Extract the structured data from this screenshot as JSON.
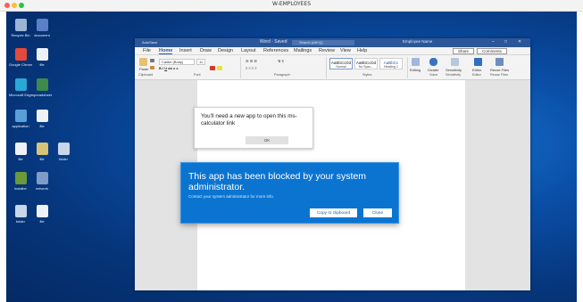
{
  "window": {
    "title": "W-EMPLOYEES",
    "dot_colors": [
      "#fe5f57",
      "#febc2e",
      "#28c840"
    ]
  },
  "desktop": {
    "icons": [
      {
        "name": "recycle-bin-icon",
        "label": "Recycle Bin",
        "color": "#9bb6d6"
      },
      {
        "name": "document-icon",
        "label": "document",
        "color": "#5b7fc8"
      },
      {
        "name": "chrome-icon",
        "label": "Google Chrome",
        "color": "#e34a3b"
      },
      {
        "name": "file-icon",
        "label": "file",
        "color": "#eef2f8"
      },
      {
        "name": "edge-icon",
        "label": "Microsoft Edge",
        "color": "#2aa7d8"
      },
      {
        "name": "spreadsheet-icon",
        "label": "spreadsheet",
        "color": "#3d8a4a"
      },
      {
        "name": "app-icon",
        "label": "application",
        "color": "#5aa0d8"
      },
      {
        "name": "file-icon",
        "label": "file",
        "color": "#eef2f8"
      },
      {
        "name": "file-icon",
        "label": "file",
        "color": "#eef2f8"
      },
      {
        "name": "file-icon",
        "label": "file",
        "color": "#d8c37a"
      },
      {
        "name": "folder-icon",
        "label": "folder",
        "color": "#c8d6ea"
      },
      {
        "name": "installer-icon",
        "label": "installer",
        "color": "#6a9a3a"
      },
      {
        "name": "network-icon",
        "label": "network",
        "color": "#7e9cc6"
      },
      {
        "name": "folder-icon",
        "label": "folder",
        "color": "#c8d6ea"
      },
      {
        "name": "file-icon",
        "label": "file",
        "color": "#eef2f8"
      }
    ]
  },
  "word": {
    "autosave": "AutoSave",
    "doc_title": "Word - Saved",
    "search_placeholder": "Search (Alt+Q)",
    "user": "Employee Name",
    "menu": [
      "File",
      "Home",
      "Insert",
      "Draw",
      "Design",
      "Layout",
      "References",
      "Mailings",
      "Review",
      "View",
      "Help"
    ],
    "active_menu": "Home",
    "share": "Share",
    "comments": "Comments",
    "ribbon": {
      "paste": "Paste",
      "font_name": "Calibri (Body)",
      "font_size": "11",
      "groups": [
        "Clipboard",
        "Font",
        "Paragraph",
        "Styles",
        "Voice",
        "Sensitivity",
        "Editor",
        "Reuse Files"
      ],
      "styles": [
        {
          "sample": "AaBbCcDd",
          "name": "Normal"
        },
        {
          "sample": "AaBbCcDd",
          "name": "No Spac..."
        },
        {
          "sample": "AaBbCc",
          "name": "Heading 1"
        }
      ],
      "editing": "Editing",
      "dictate": "Dictate",
      "sensitivity": "Sensitivity",
      "editor": "Editor",
      "reuse": "Reuse Files"
    }
  },
  "small_dialog": {
    "message": "You'll need a new app to open this ms-calculator link",
    "ok": "OK"
  },
  "block_dialog": {
    "title": "This app has been blocked by your system administrator.",
    "subtitle": "Contact your system administrator for more info.",
    "copy_button": "Copy to clipboard",
    "close_button": "Close"
  }
}
